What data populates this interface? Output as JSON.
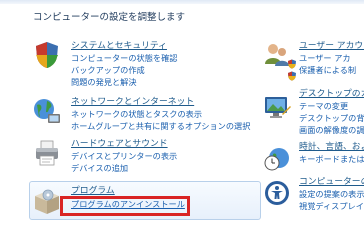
{
  "page_title": "コンピューターの設定を調整します",
  "left": [
    {
      "title": "システムとセキュリティ",
      "links": [
        "コンピューターの状態を確認",
        "バックアップの作成",
        "問題の発見と解決"
      ]
    },
    {
      "title": "ネットワークとインターネット",
      "links": [
        "ネットワークの状態とタスクの表示",
        "ホームグループと共有に関するオプションの選択"
      ]
    },
    {
      "title": "ハードウェアとサウンド",
      "links": [
        "デバイスとプリンターの表示",
        "デバイスの追加"
      ]
    },
    {
      "title": "プログラム",
      "links": [
        "プログラムのアンインストール"
      ]
    }
  ],
  "right": [
    {
      "title": "ユーザー アカウン",
      "links": [
        "ユーザー アカ",
        "保護者による制"
      ]
    },
    {
      "title": "デスクトップのカ",
      "links": [
        "テーマの変更",
        "デスクトップの背",
        "画面の解像度の調"
      ]
    },
    {
      "title": "時計、言語、およ",
      "links": [
        "キーボードまたは"
      ]
    },
    {
      "title": "コンピューターの",
      "links": [
        "設定の提案の表示",
        "視覚ディスプレイ"
      ]
    }
  ]
}
